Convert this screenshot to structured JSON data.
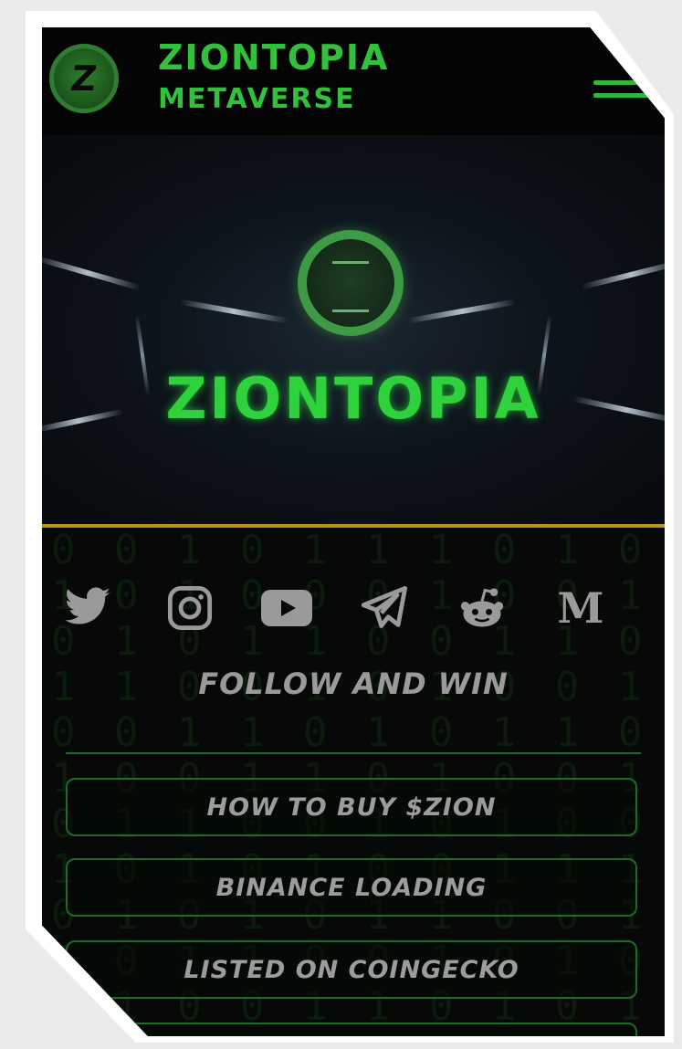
{
  "header": {
    "logo_letter": "Z",
    "title": "ZIONTOPIA",
    "subtitle": "METAVERSE",
    "menu_icon": "hamburger-menu-icon"
  },
  "hero": {
    "title": "ZIONTOPIA"
  },
  "social": [
    {
      "icon": "twitter-icon"
    },
    {
      "icon": "instagram-icon"
    },
    {
      "icon": "youtube-icon"
    },
    {
      "icon": "telegram-icon"
    },
    {
      "icon": "reddit-icon"
    },
    {
      "icon": "medium-icon",
      "glyph": "M"
    }
  ],
  "follow_text": "FOLLOW AND WIN",
  "buttons": [
    {
      "label": "HOW TO BUY $ZION"
    },
    {
      "label": "BINANCE LOADING"
    },
    {
      "label": "LISTED ON COINGECKO"
    }
  ],
  "colors": {
    "brand_green": "#31c13a",
    "background": "#050806",
    "gold_divider": "#b8921a",
    "button_border": "#1f6a26",
    "muted_text": "#9c9c9c"
  }
}
